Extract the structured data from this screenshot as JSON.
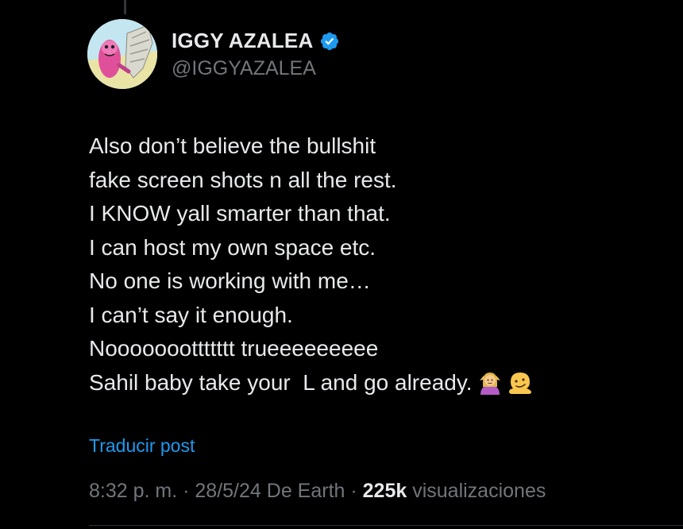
{
  "author": {
    "display_name": "IGGY AZALEA",
    "handle": "@IGGYAZALEA",
    "avatar_icon": "cartoon-avatar"
  },
  "tweet": {
    "lines": [
      "Also don’t believe the bullshit",
      "fake screen shots n all the rest.",
      "I KNOW yall smarter than that.",
      "I can host my own space etc.",
      "No one is working with me…",
      "I can’t say it enough.",
      "Nooooooottttttt trueeeeeeeee",
      "Sahil baby take your  L and go already."
    ],
    "trailing_emojis": [
      "woman-shrugging",
      "melting-face"
    ]
  },
  "translate_label": "Traducir post",
  "meta": {
    "time": "8:32 p. m.",
    "sep1": " · ",
    "date": "28/5/24",
    "source": " De Earth",
    "sep2": " · ",
    "views_count": "225k",
    "views_label": " visualizaciones"
  },
  "colors": {
    "background": "#000000",
    "text": "#e7e9ea",
    "secondary": "#71767b",
    "link": "#1d9bf0",
    "verified": "#1d9bf0"
  }
}
